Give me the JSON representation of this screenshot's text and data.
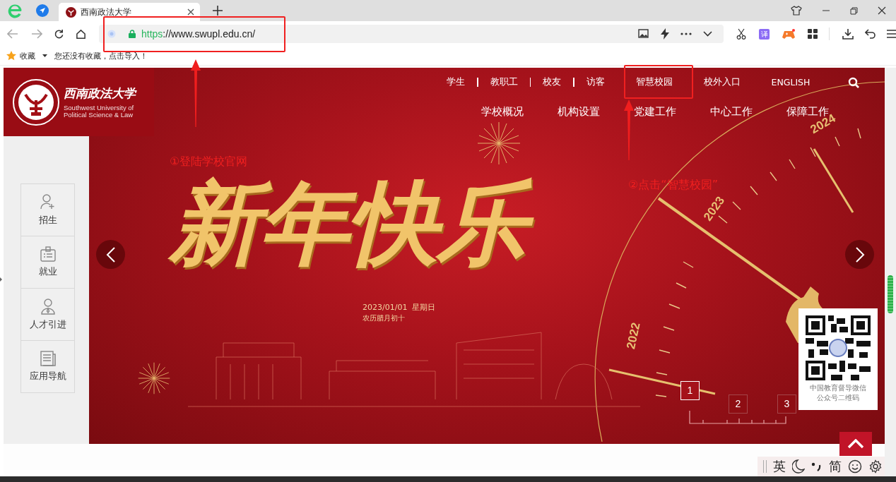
{
  "browser": {
    "tabs": [
      {
        "title": "西南政法大学",
        "selected": true
      }
    ],
    "url": {
      "scheme": "https",
      "rest": "://www.swupl.edu.cn/"
    },
    "translate_badge": "译",
    "bookmarks": {
      "label": "收藏",
      "hint": "您还没有收藏，点击导入！"
    }
  },
  "site": {
    "logo": {
      "name_cn": "西南政法大学",
      "name_en": [
        "Southwest University of",
        "Political Science & Law"
      ]
    },
    "audience_links": [
      "学生",
      "教职工",
      "校友",
      "访客"
    ],
    "quick_links": [
      "智慧校园",
      "校外入口",
      "ENGLISH"
    ],
    "main_nav": [
      "学校概况",
      "机构设置",
      "党建工作",
      "中心工作",
      "保障工作"
    ],
    "side_menu": [
      {
        "label": "招生",
        "kind": "add-user"
      },
      {
        "label": "就业",
        "kind": "badge"
      },
      {
        "label": "人才引进",
        "kind": "person"
      },
      {
        "label": "应用导航",
        "kind": "document"
      }
    ],
    "banner": {
      "headline": "新年快乐",
      "date": "2023/01/01  星期日",
      "lunar": "农历腊月初十",
      "years": [
        "2022",
        "2023",
        "2024"
      ],
      "slides": [
        {
          "label": "1",
          "selected": true
        },
        {
          "label": "2",
          "selected": false
        },
        {
          "label": "3",
          "selected": false
        }
      ]
    },
    "qr_caption": [
      "中国教育督导微信",
      "公众号二维码"
    ]
  },
  "annotations": [
    {
      "text": "①登陆学校官网"
    },
    {
      "text": "②点击“智慧校园”"
    }
  ],
  "ime": {
    "language": "英",
    "script": "简"
  }
}
